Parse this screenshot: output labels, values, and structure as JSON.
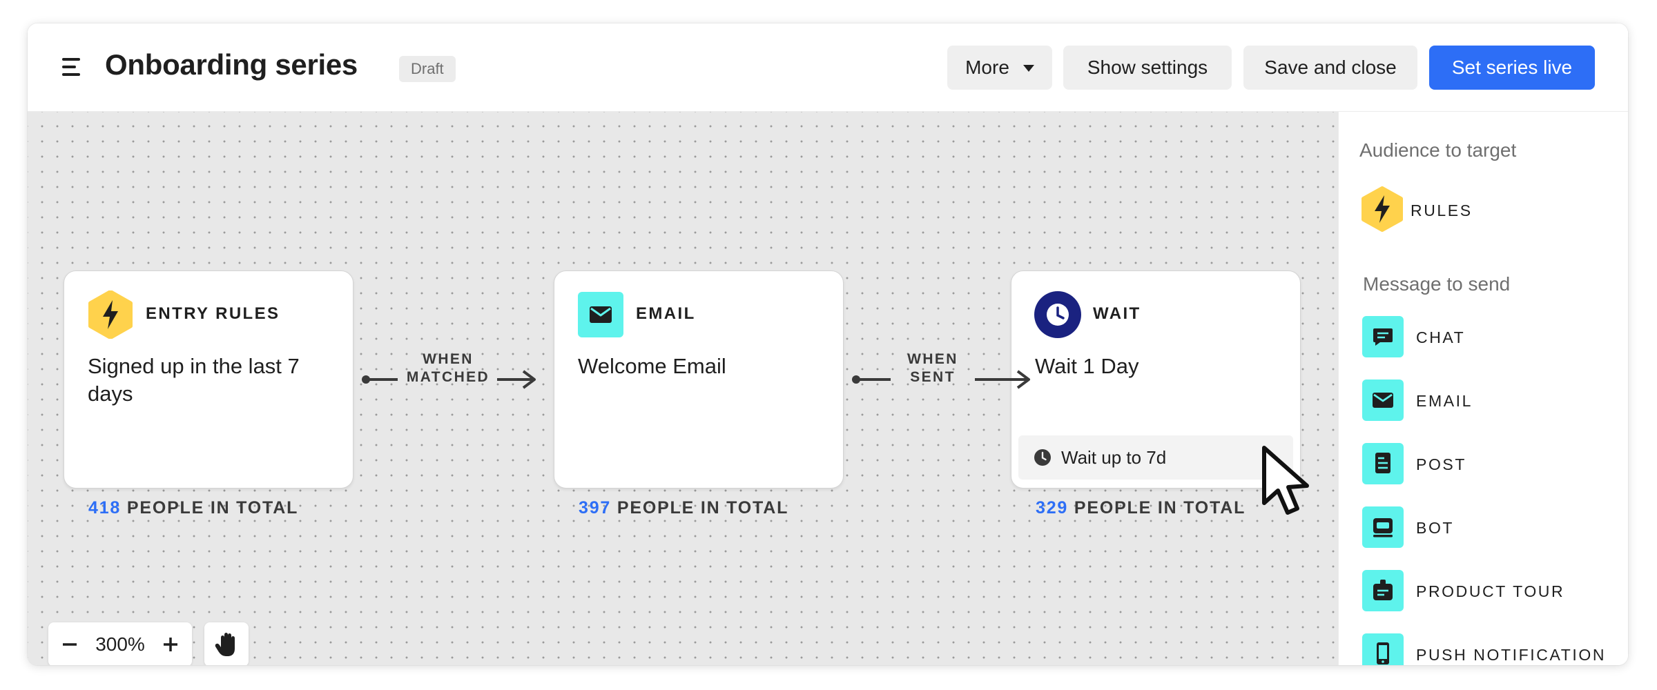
{
  "header": {
    "title": "Onboarding series",
    "status_badge": "Draft",
    "buttons": {
      "more": "More",
      "show_settings": "Show settings",
      "save_and_close": "Save and close",
      "set_live": "Set series live"
    }
  },
  "colors": {
    "accent_blue": "#2d6ef6",
    "entry_yellow": "#ffd24c",
    "email_cyan": "#5ef3ec",
    "wait_navy": "#1a2280",
    "canvas_bg": "#e8e8e8"
  },
  "canvas": {
    "nodes": [
      {
        "type": "ENTRY RULES",
        "icon": "lightning-icon",
        "body": "Signed up in the last 7 days",
        "count": "418",
        "count_label": "PEOPLE IN TOTAL"
      },
      {
        "type": "EMAIL",
        "icon": "envelope-icon",
        "body": "Welcome Email",
        "count": "397",
        "count_label": "PEOPLE IN TOTAL"
      },
      {
        "type": "WAIT",
        "icon": "clock-icon",
        "body": "Wait 1 Day",
        "chip": "Wait up to 7d",
        "count": "329",
        "count_label": "PEOPLE IN TOTAL"
      }
    ],
    "edges": [
      {
        "line1": "WHEN",
        "line2": "MATCHED"
      },
      {
        "line1": "WHEN",
        "line2": "SENT"
      }
    ],
    "zoom": {
      "value": "300%"
    }
  },
  "panel": {
    "audience_title": "Audience to target",
    "audience_items": [
      {
        "label": "RULES",
        "icon": "lightning-icon"
      }
    ],
    "message_title": "Message to send",
    "message_items": [
      {
        "label": "CHAT",
        "icon": "chat-icon"
      },
      {
        "label": "EMAIL",
        "icon": "envelope-icon"
      },
      {
        "label": "POST",
        "icon": "post-icon"
      },
      {
        "label": "BOT",
        "icon": "bot-icon"
      },
      {
        "label": "PRODUCT TOUR",
        "icon": "product-tour-icon"
      },
      {
        "label": "PUSH NOTIFICATION",
        "icon": "mobile-icon"
      }
    ]
  }
}
